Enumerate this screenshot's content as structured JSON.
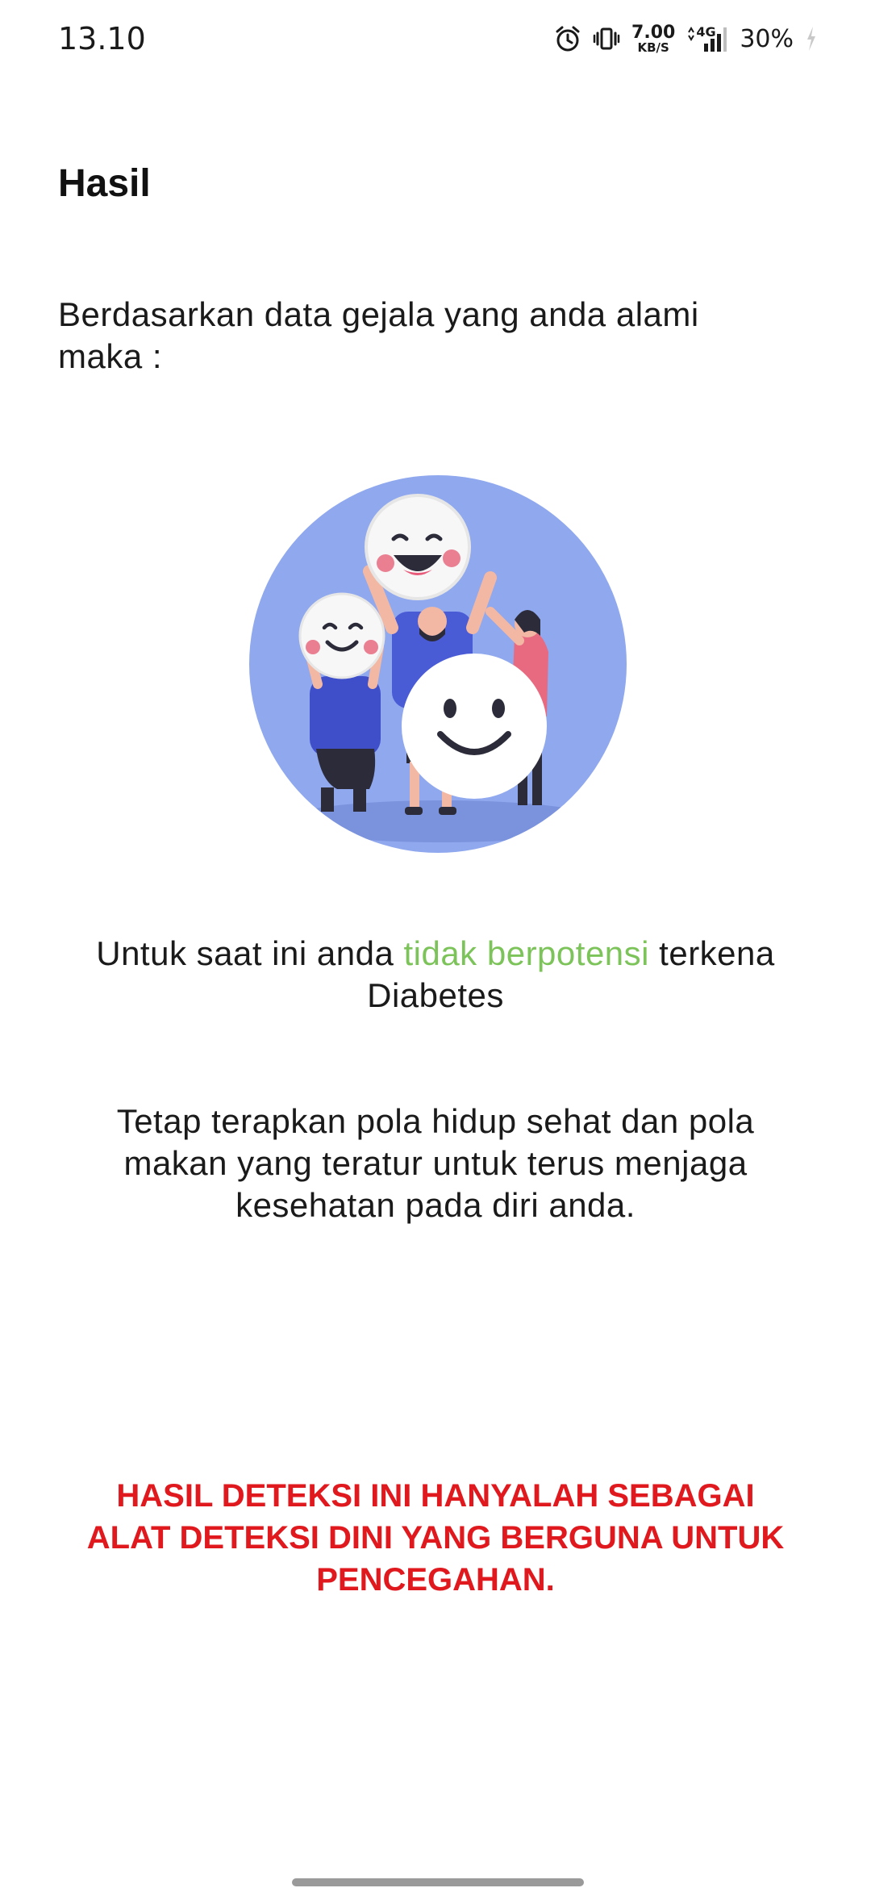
{
  "status_bar": {
    "time": "13.10",
    "net_speed_value": "7.00",
    "net_speed_unit": "KB/S",
    "network_type": "4G",
    "battery": "30%",
    "icons": [
      "alarm-icon",
      "vibrate-icon",
      "network-speed",
      "signal-icon",
      "battery-icon"
    ]
  },
  "page": {
    "title": "Hasil",
    "intro": "Berdasarkan data gejala yang anda alami maka :"
  },
  "result": {
    "prefix": "Untuk saat ini anda ",
    "highlight": "tidak berpotensi",
    "suffix": " terkena Diabetes",
    "highlight_color": "#7cc35a"
  },
  "advice": "Tetap terapkan pola hidup sehat dan pola makan yang teratur untuk terus menjaga kesehatan pada diri anda.",
  "disclaimer": {
    "text": "HASIL DETEKSI INI HANYALAH SEBAGAI ALAT DETEKSI DINI YANG BERGUNA UNTUK PENCEGAHAN.",
    "color": "#e0191e"
  },
  "illustration": {
    "icon": "happy-people-illustration",
    "background_color": "#8fa8ee"
  }
}
